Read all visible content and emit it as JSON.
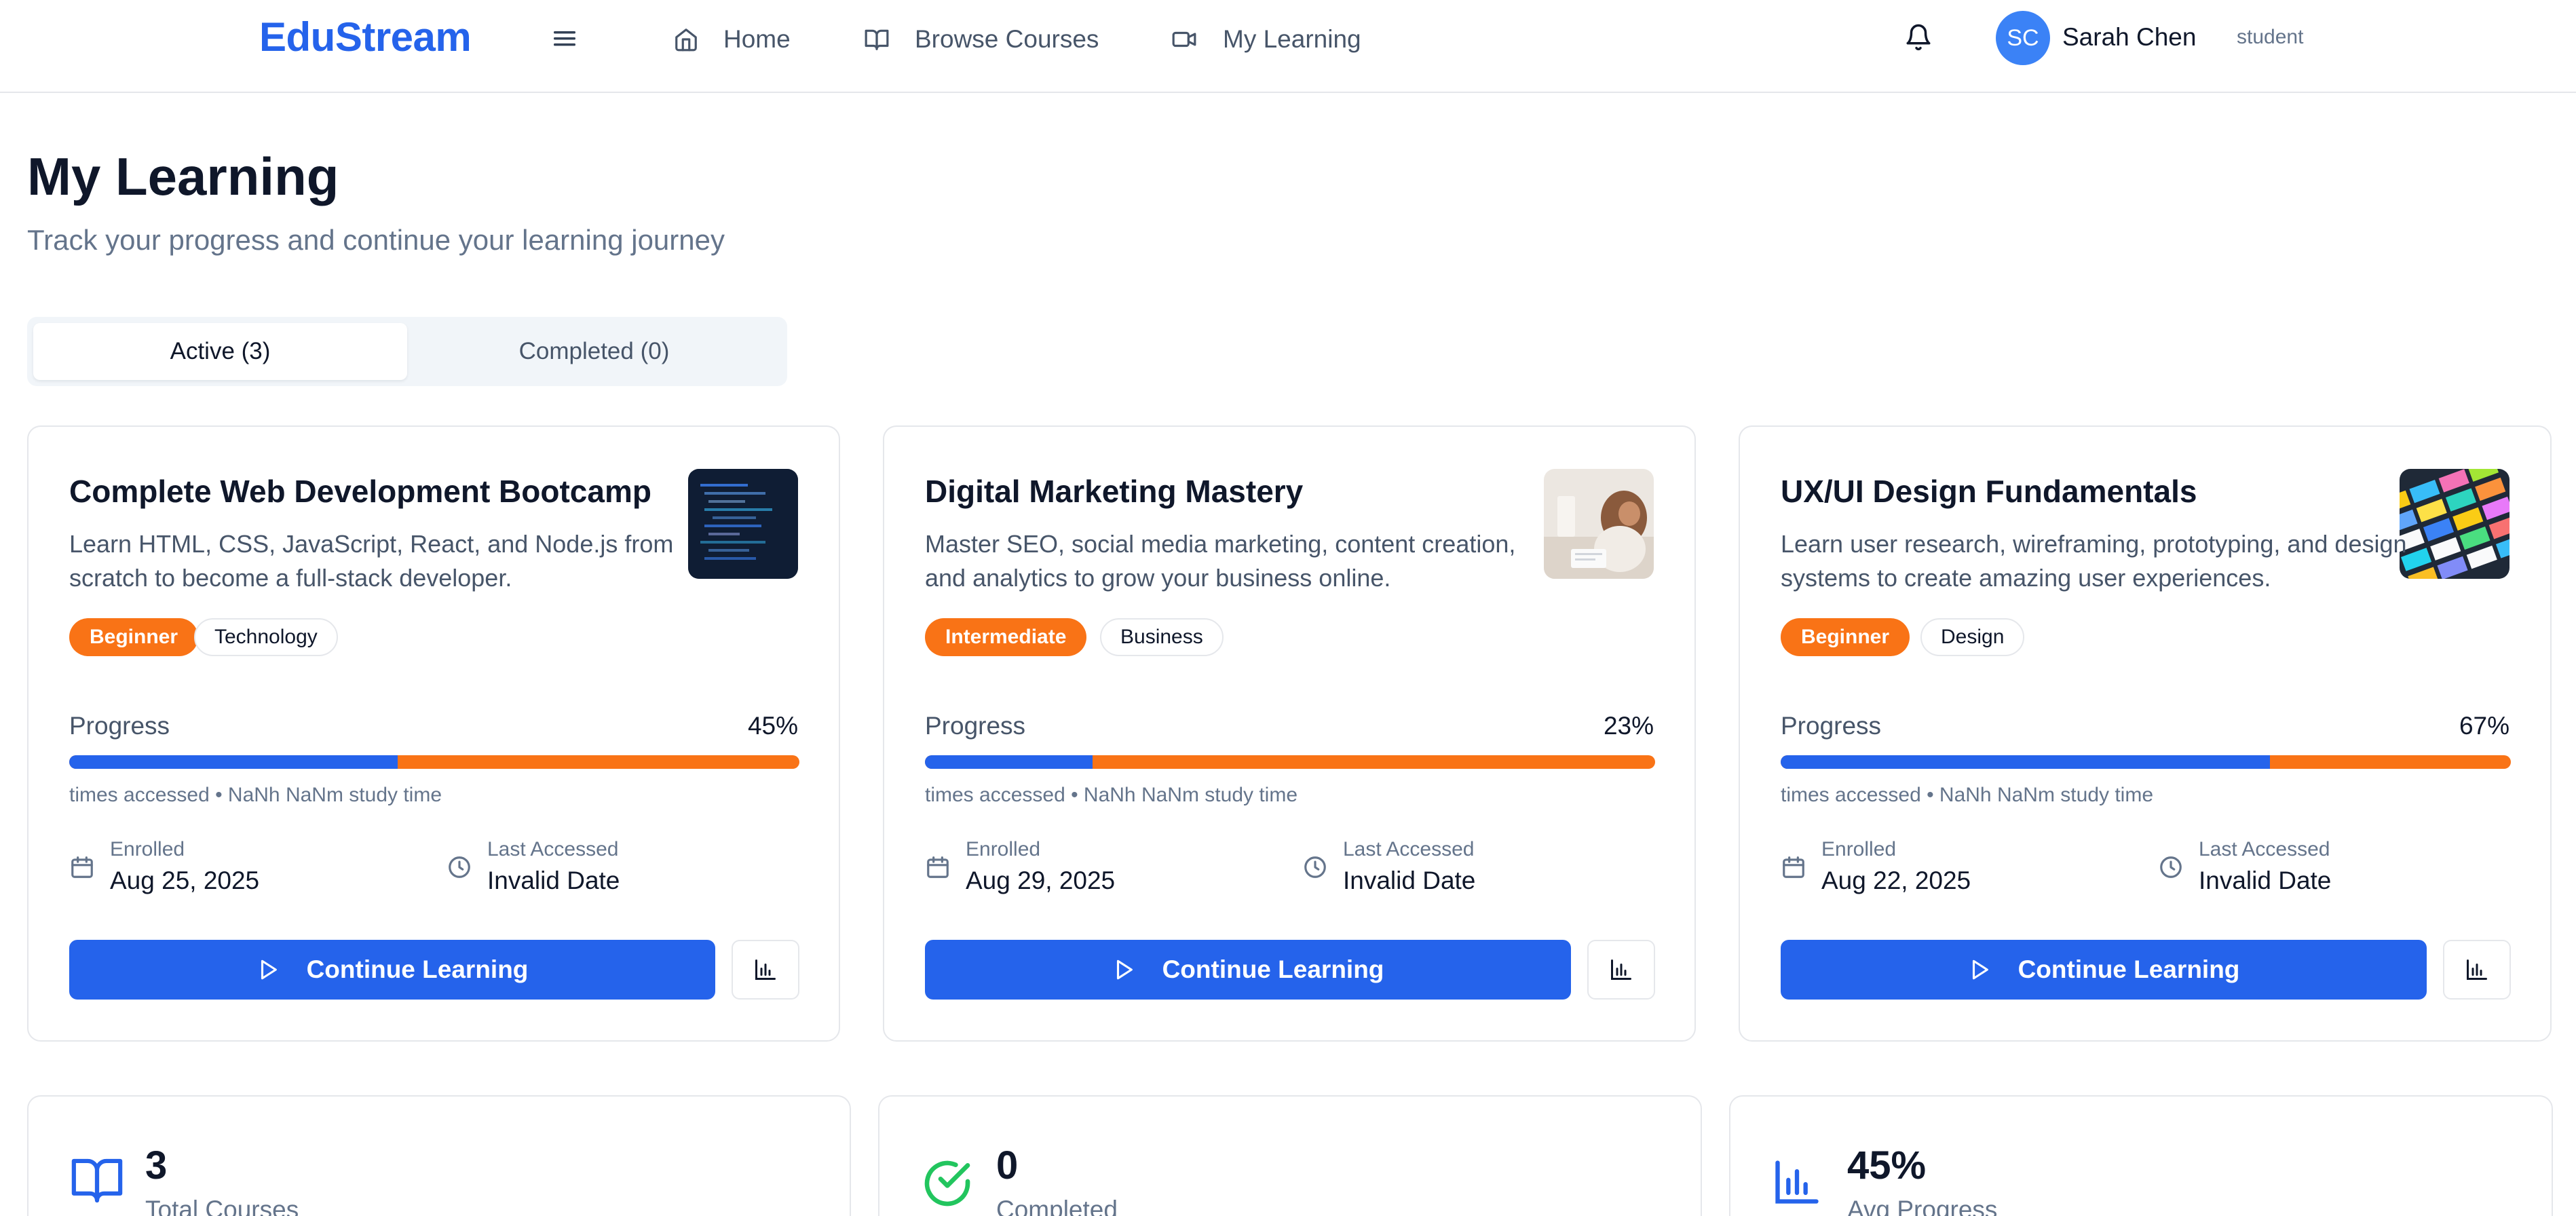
{
  "header": {
    "logo": "EduStream",
    "nav": [
      {
        "label": "Home",
        "icon": "home-icon"
      },
      {
        "label": "Browse Courses",
        "icon": "book-open-icon"
      },
      {
        "label": "My Learning",
        "icon": "video-icon"
      }
    ],
    "user": {
      "initials": "SC",
      "name": "Sarah Chen",
      "role": "student"
    }
  },
  "page": {
    "title": "My Learning",
    "subtitle": "Track your progress and continue your learning journey"
  },
  "tabs": [
    {
      "label": "Active (3)",
      "active": true
    },
    {
      "label": "Completed (0)",
      "active": false
    }
  ],
  "colors": {
    "brand": "#2563eb",
    "accent": "#f97316",
    "success": "#22c55e"
  },
  "courses": [
    {
      "title": "Complete Web Development Bootcamp",
      "description": "Learn HTML, CSS, JavaScript, React, and Node.js from scratch to become a full-stack developer.",
      "level": "Beginner",
      "category": "Technology",
      "progress_label": "Progress",
      "progress_text": "45%",
      "progress": 0.45,
      "access_text": "times accessed • NaNh NaNm study time",
      "enrolled_label": "Enrolled",
      "enrolled_date": "Aug 25, 2025",
      "last_label": "Last Accessed",
      "last_value": "Invalid Date",
      "button_label": "Continue Learning"
    },
    {
      "title": "Digital Marketing Mastery",
      "description": "Master SEO, social media marketing, content creation, and analytics to grow your business online.",
      "level": "Intermediate",
      "category": "Business",
      "progress_label": "Progress",
      "progress_text": "23%",
      "progress": 0.23,
      "access_text": "times accessed • NaNh NaNm study time",
      "enrolled_label": "Enrolled",
      "enrolled_date": "Aug 29, 2025",
      "last_label": "Last Accessed",
      "last_value": "Invalid Date",
      "button_label": "Continue Learning"
    },
    {
      "title": "UX/UI Design Fundamentals",
      "description": "Learn user research, wireframing, prototyping, and design systems to create amazing user experiences.",
      "level": "Beginner",
      "category": "Design",
      "progress_label": "Progress",
      "progress_text": "67%",
      "progress": 0.67,
      "access_text": "times accessed • NaNh NaNm study time",
      "enrolled_label": "Enrolled",
      "enrolled_date": "Aug 22, 2025",
      "last_label": "Last Accessed",
      "last_value": "Invalid Date",
      "button_label": "Continue Learning"
    }
  ],
  "stats": [
    {
      "value": "3",
      "label": "Total Courses",
      "icon": "book-open-icon"
    },
    {
      "value": "0",
      "label": "Completed",
      "icon": "check-circle-icon"
    },
    {
      "value": "45%",
      "label": "Avg Progress",
      "icon": "bar-chart-icon"
    }
  ]
}
